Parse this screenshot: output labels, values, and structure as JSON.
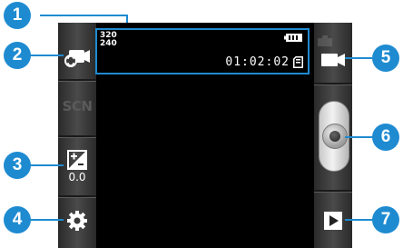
{
  "colors": {
    "accent": "#1e8bd1",
    "screen_bg": "#000000"
  },
  "callouts": [
    "1",
    "2",
    "3",
    "4",
    "5",
    "6",
    "7"
  ],
  "left_panel": {
    "switch_camera_icon": "switch-camera-icon",
    "scene_mode_label": "SCN",
    "exposure_icon": "exposure-icon",
    "exposure_value": "0.0",
    "settings_icon": "gear-icon"
  },
  "right_panel": {
    "mode_icon": "camcorder-icon",
    "shutter_icon": "record-shutter-icon",
    "gallery_icon": "play-icon"
  },
  "status": {
    "resolution_width": "320",
    "resolution_height": "240",
    "elapsed_time": "01:02:02",
    "battery_icon": "battery-icon",
    "storage_icon": "memory-card-icon"
  }
}
